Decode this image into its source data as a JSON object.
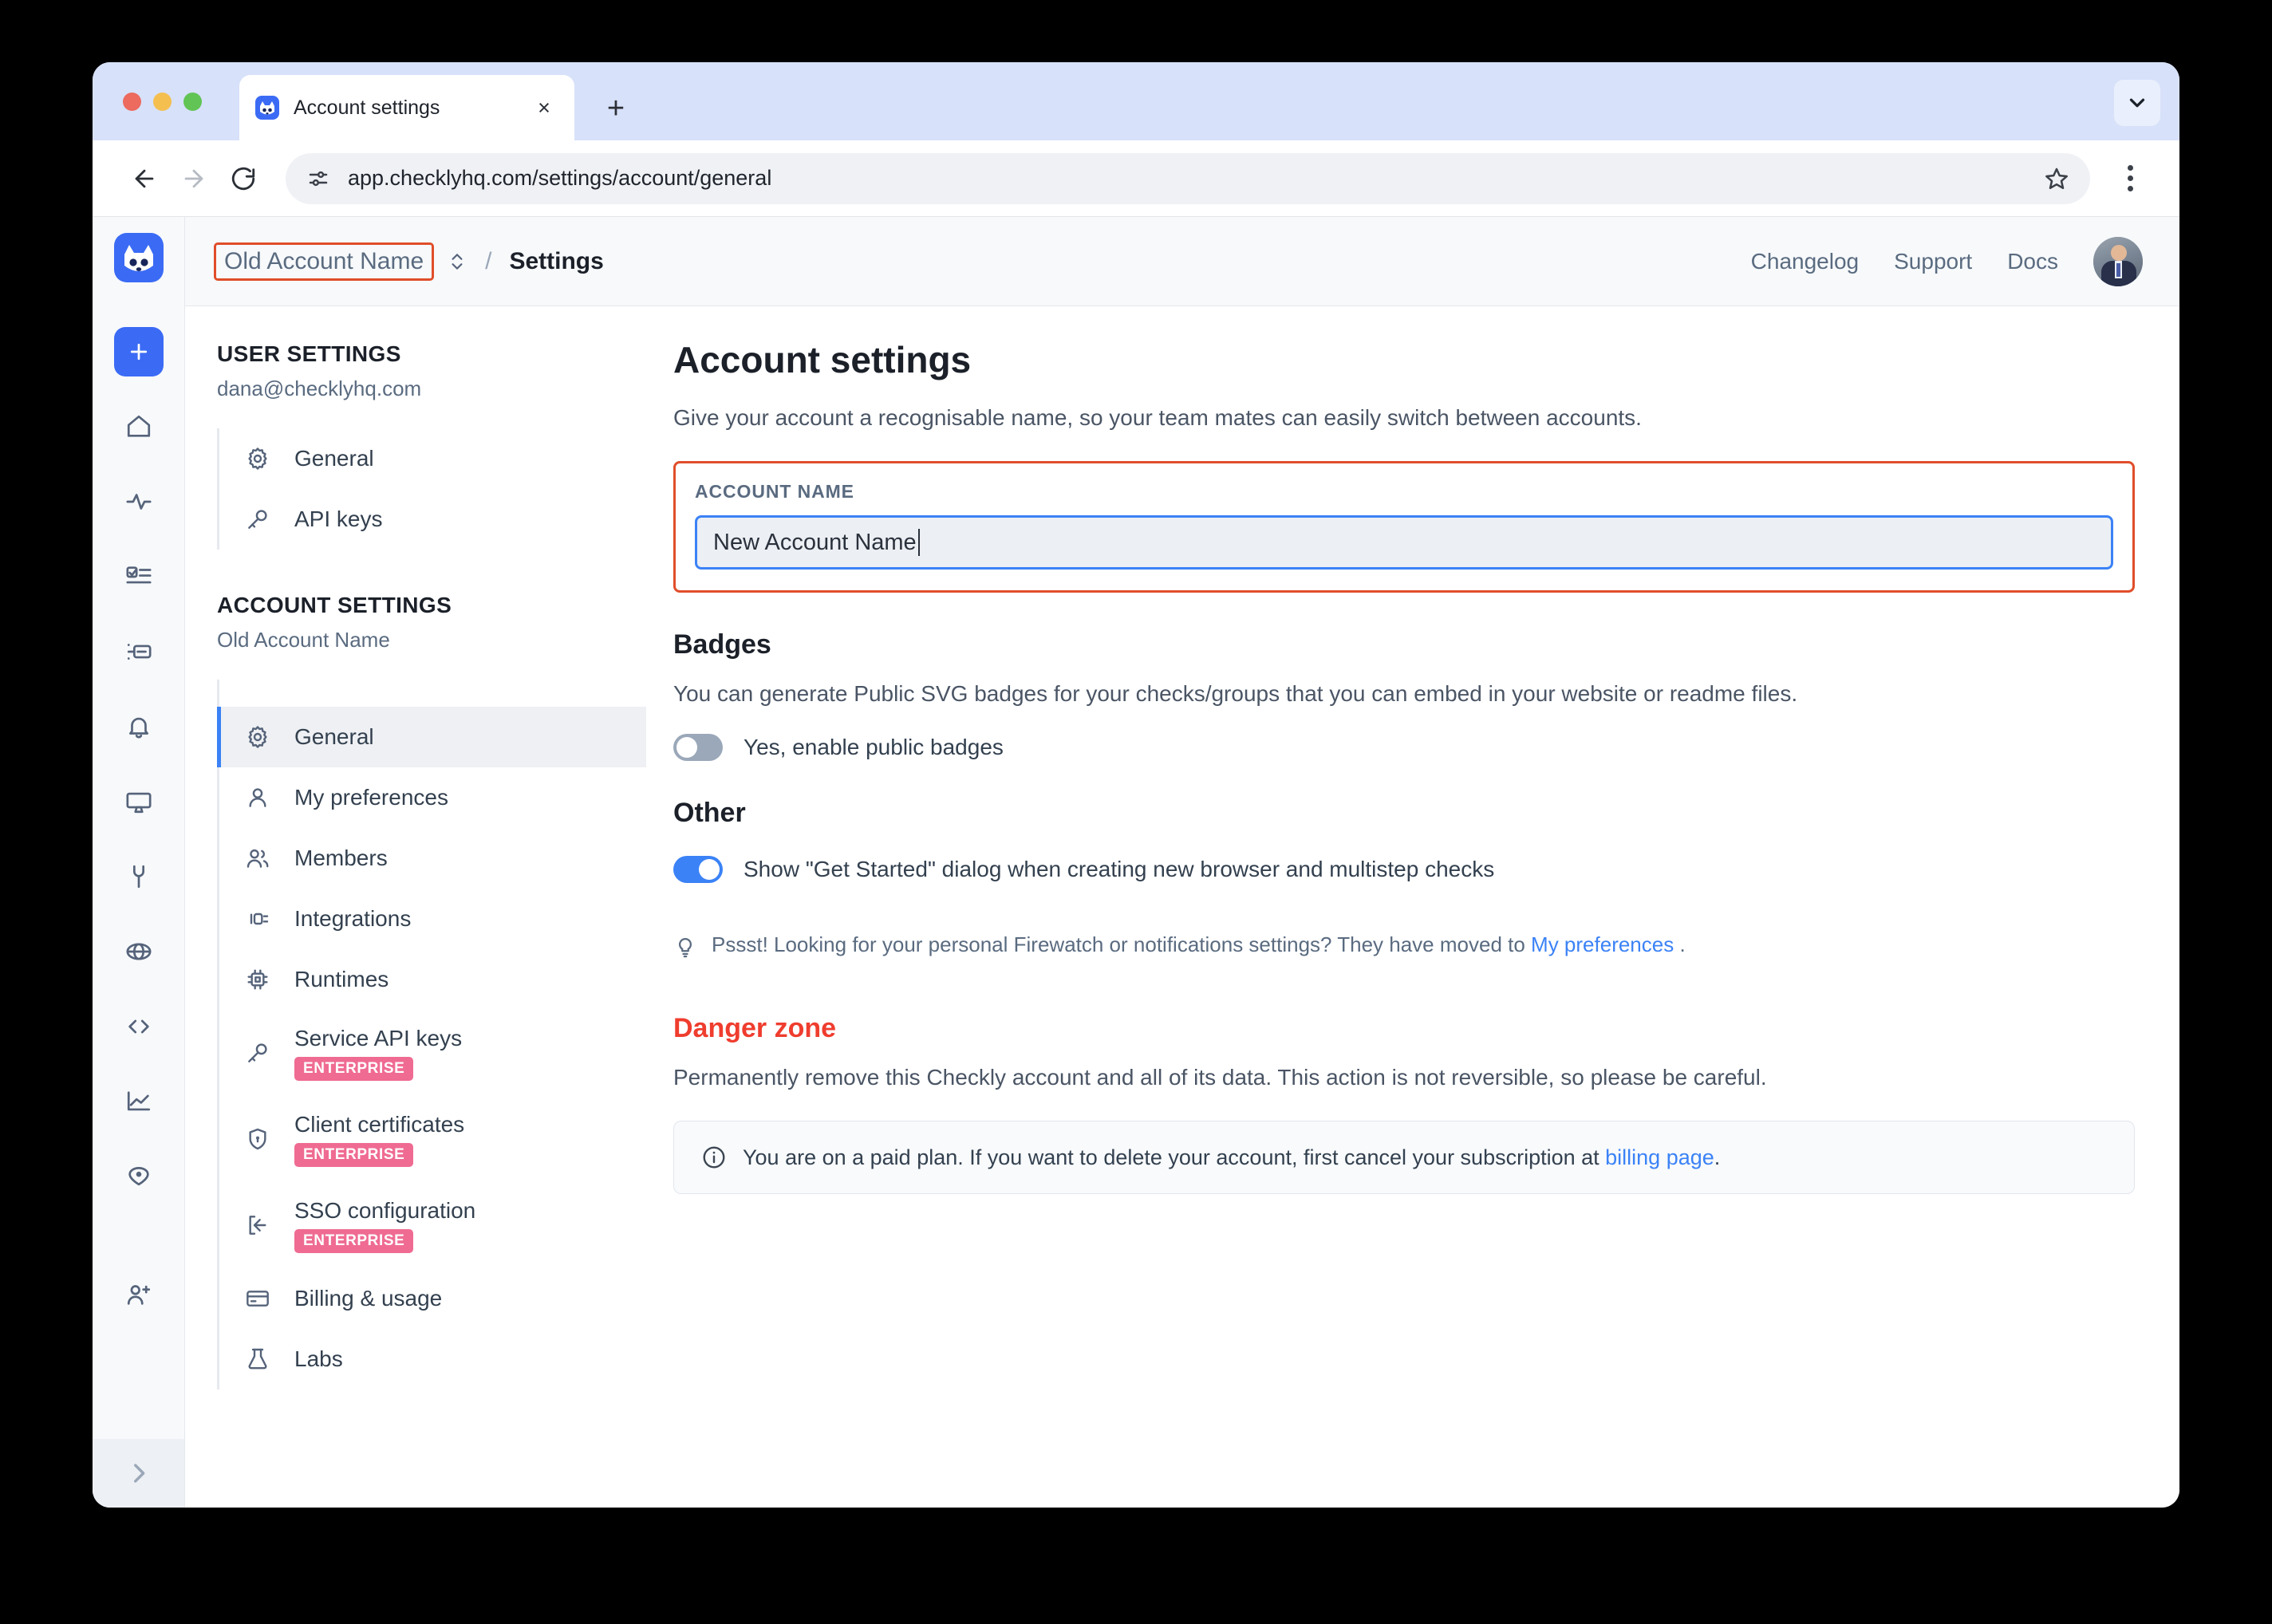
{
  "browser": {
    "tab": {
      "title": "Account settings",
      "favicon": "checkly-logo-icon",
      "close": "×"
    },
    "new_tab_label": "+",
    "url": "app.checklyhq.com/settings/account/general",
    "back_icon": "arrow-left-icon",
    "forward_icon": "arrow-right-icon",
    "reload_icon": "reload-icon",
    "site_info_icon": "site-settings-icon",
    "bookmark_icon": "star-icon",
    "menu_icon": "kebab-menu-icon",
    "tabstrip_expand_icon": "chevron-down-icon"
  },
  "rail": {
    "logo": "checkly-logo-icon",
    "add_label": "+",
    "items": [
      {
        "icon": "home-icon",
        "name": "home"
      },
      {
        "icon": "activity-icon",
        "name": "checks"
      },
      {
        "icon": "checklist-icon",
        "name": "check-results"
      },
      {
        "icon": "status-page-icon",
        "name": "status-pages"
      },
      {
        "icon": "bell-icon",
        "name": "alerts"
      },
      {
        "icon": "monitor-icon",
        "name": "dashboards"
      },
      {
        "icon": "wrench-icon",
        "name": "maintenance"
      },
      {
        "icon": "globe-icon",
        "name": "locations"
      },
      {
        "icon": "code-icon",
        "name": "code"
      },
      {
        "icon": "chart-icon",
        "name": "analytics"
      },
      {
        "icon": "pin-icon",
        "name": "private-locations"
      }
    ],
    "invite_icon": "invite-user-icon",
    "expand_icon": "chevron-right-icon"
  },
  "header": {
    "account_name": "Old Account Name",
    "switch_icon": "chevron-up-down-icon",
    "separator": "/",
    "page": "Settings",
    "links": [
      "Changelog",
      "Support",
      "Docs"
    ],
    "avatar": "user-avatar"
  },
  "sidebar": {
    "user_settings": {
      "heading": "USER SETTINGS",
      "subtitle": "dana@checklyhq.com",
      "items": [
        {
          "label": "General",
          "icon": "gear-icon"
        },
        {
          "label": "API keys",
          "icon": "key-icon"
        }
      ]
    },
    "account_settings": {
      "heading": "ACCOUNT SETTINGS",
      "subtitle": "Old Account Name",
      "items": [
        {
          "label": "General",
          "icon": "gear-icon",
          "active": true,
          "badge": ""
        },
        {
          "label": "My preferences",
          "icon": "user-icon",
          "active": false,
          "badge": ""
        },
        {
          "label": "Members",
          "icon": "users-icon",
          "active": false,
          "badge": ""
        },
        {
          "label": "Integrations",
          "icon": "plug-icon",
          "active": false,
          "badge": ""
        },
        {
          "label": "Runtimes",
          "icon": "chip-icon",
          "active": false,
          "badge": ""
        },
        {
          "label": "Service API keys",
          "icon": "key-icon",
          "active": false,
          "badge": "ENTERPRISE"
        },
        {
          "label": "Client certificates",
          "icon": "shield-lock-icon",
          "active": false,
          "badge": "ENTERPRISE"
        },
        {
          "label": "SSO configuration",
          "icon": "login-icon",
          "active": false,
          "badge": "ENTERPRISE"
        },
        {
          "label": "Billing & usage",
          "icon": "credit-card-icon",
          "active": false,
          "badge": ""
        },
        {
          "label": "Labs",
          "icon": "flask-icon",
          "active": false,
          "badge": ""
        }
      ]
    }
  },
  "main": {
    "title": "Account settings",
    "description": "Give your account a recognisable name, so your team mates can easily switch between accounts.",
    "account_name_field": {
      "label": "ACCOUNT NAME",
      "value": "New Account Name"
    },
    "badges": {
      "title": "Badges",
      "description": "You can generate Public SVG badges for your checks/groups that you can embed in your website or readme files.",
      "toggle_label": "Yes, enable public badges",
      "toggle_on": false
    },
    "other": {
      "title": "Other",
      "toggle_label": "Show \"Get Started\" dialog when creating new browser and multistep checks",
      "toggle_on": true
    },
    "hint": {
      "icon": "lightbulb-icon",
      "text_before": "Pssst! Looking for your personal Firewatch or notifications settings? They have moved to ",
      "link": "My preferences",
      "text_after": " ."
    },
    "danger": {
      "title": "Danger zone",
      "description": "Permanently remove this Checkly account and all of its data. This action is not reversible, so please be careful.",
      "notice_icon": "info-icon",
      "notice_before": "You are on a paid plan. If you want to delete your account, first cancel your subscription at ",
      "notice_link": "billing page",
      "notice_after": "."
    }
  },
  "colors": {
    "accent_blue": "#3b82f6",
    "annotation_red": "#e04e2a",
    "danger_red": "#ef3d2e",
    "enterprise_pink": "#ef6b92",
    "toggle_off": "#9aa8b9"
  }
}
